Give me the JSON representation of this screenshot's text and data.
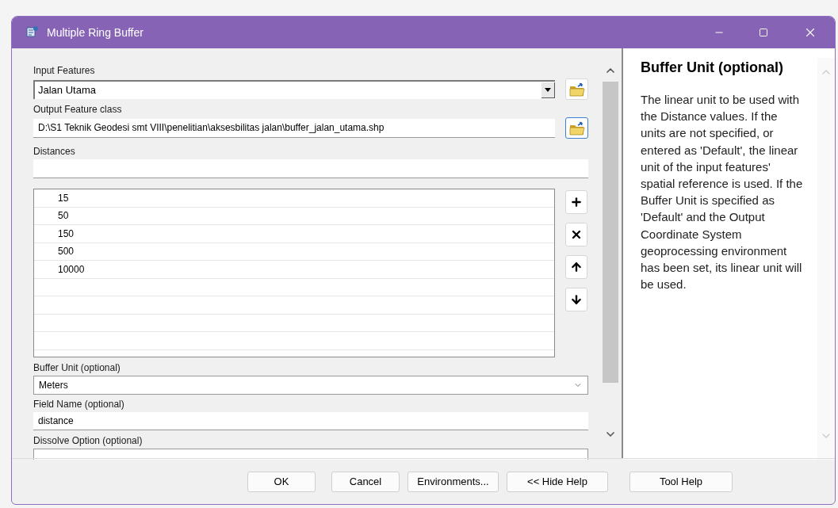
{
  "window": {
    "title": "Multiple Ring Buffer"
  },
  "input_features": {
    "label": "Input Features",
    "value": "Jalan Utama"
  },
  "output_feature_class": {
    "label": "Output Feature class",
    "value": "D:\\S1 Teknik Geodesi smt VIII\\penelitian\\aksesbilitas jalan\\buffer_jalan_utama.shp"
  },
  "distances": {
    "label": "Distances",
    "rows": [
      "15",
      "50",
      "150",
      "500",
      "10000"
    ]
  },
  "buffer_unit": {
    "label": "Buffer Unit (optional)",
    "value": "Meters"
  },
  "field_name": {
    "label": "Field Name (optional)",
    "value": "distance"
  },
  "dissolve_option": {
    "label": "Dissolve Option (optional)"
  },
  "buttons": [
    "OK",
    "Cancel",
    "Environments...",
    "<< Hide Help"
  ],
  "help": {
    "title": "Buffer Unit (optional)",
    "text": "The linear unit to be used with the Distance values. If the units are not specified, or entered as 'Default', the linear unit of the input features' spatial reference is used. If the Buffer Unit is specified as 'Default' and the Output Coordinate System geoprocessing environment has been set, its linear unit will be used.",
    "button": "Tool Help"
  }
}
